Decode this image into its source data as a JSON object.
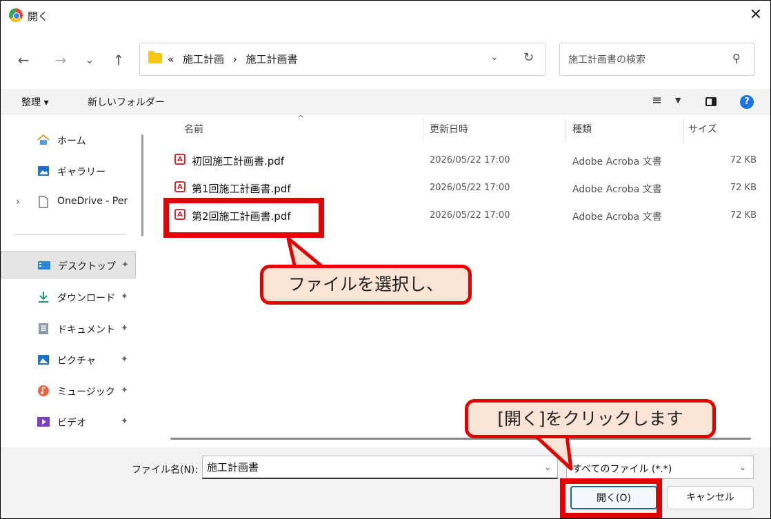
{
  "window": {
    "title": "開く",
    "close_glyph": "✕"
  },
  "nav": {
    "back": "←",
    "forward": "→",
    "recent": "⌄",
    "up": "↑",
    "breadcrumb": [
      "«",
      "施工計画",
      "›",
      "施工計画書"
    ],
    "refresh": "↻",
    "search_placeholder": "施工計画書の検索"
  },
  "toolbar": {
    "organize": "整理 ▾",
    "new_folder": "新しいフォルダー",
    "view_glyph": "≡"
  },
  "sidebar": {
    "items": [
      {
        "label": "ホーム",
        "icon": "home-icon",
        "pinned": false
      },
      {
        "label": "ギャラリー",
        "icon": "gallery-icon",
        "pinned": false
      },
      {
        "label": "OneDrive - Per",
        "icon": "document-icon",
        "pinned": false
      },
      {
        "label": "デスクトップ",
        "icon": "desktop-icon",
        "pinned": true
      },
      {
        "label": "ダウンロード",
        "icon": "download-icon",
        "pinned": true
      },
      {
        "label": "ドキュメント",
        "icon": "documents-icon",
        "pinned": true
      },
      {
        "label": "ピクチャ",
        "icon": "pictures-icon",
        "pinned": true
      },
      {
        "label": "ミュージック",
        "icon": "music-icon",
        "pinned": true
      },
      {
        "label": "ビデオ",
        "icon": "video-icon",
        "pinned": true
      }
    ],
    "expand_glyph": "›",
    "pin_glyph": "📌"
  },
  "columns": {
    "name": "名前",
    "modified": "更新日時",
    "type": "種類",
    "size": "サイズ"
  },
  "files": [
    {
      "name": "初回施工計画書.pdf",
      "modified": "2026/05/22 17:00",
      "type": "Adobe Acroba 文書",
      "size": "72 KB"
    },
    {
      "name": "第1回施工計画書.pdf",
      "modified": "2026/05/22 17:00",
      "type": "Adobe Acroba 文書",
      "size": "72 KB"
    },
    {
      "name": "第2回施工計画書.pdf",
      "modified": "2026/05/22 17:00",
      "type": "Adobe Acroba 文書",
      "size": "72 KB"
    }
  ],
  "footer": {
    "filename_label": "ファイル名(N):",
    "filename_value": "施工計画書",
    "filter_value": "すべてのファイル (*.*)",
    "open_button": "開く(O)",
    "cancel_button": "キャンセル"
  },
  "annotations": {
    "callout_select": "ファイルを選択し、",
    "callout_open": "[開く]をクリックします"
  },
  "colors": {
    "annotation_red": "#e30000",
    "callout_fill": "#fbe4d5",
    "accent": "#1a73e8"
  }
}
